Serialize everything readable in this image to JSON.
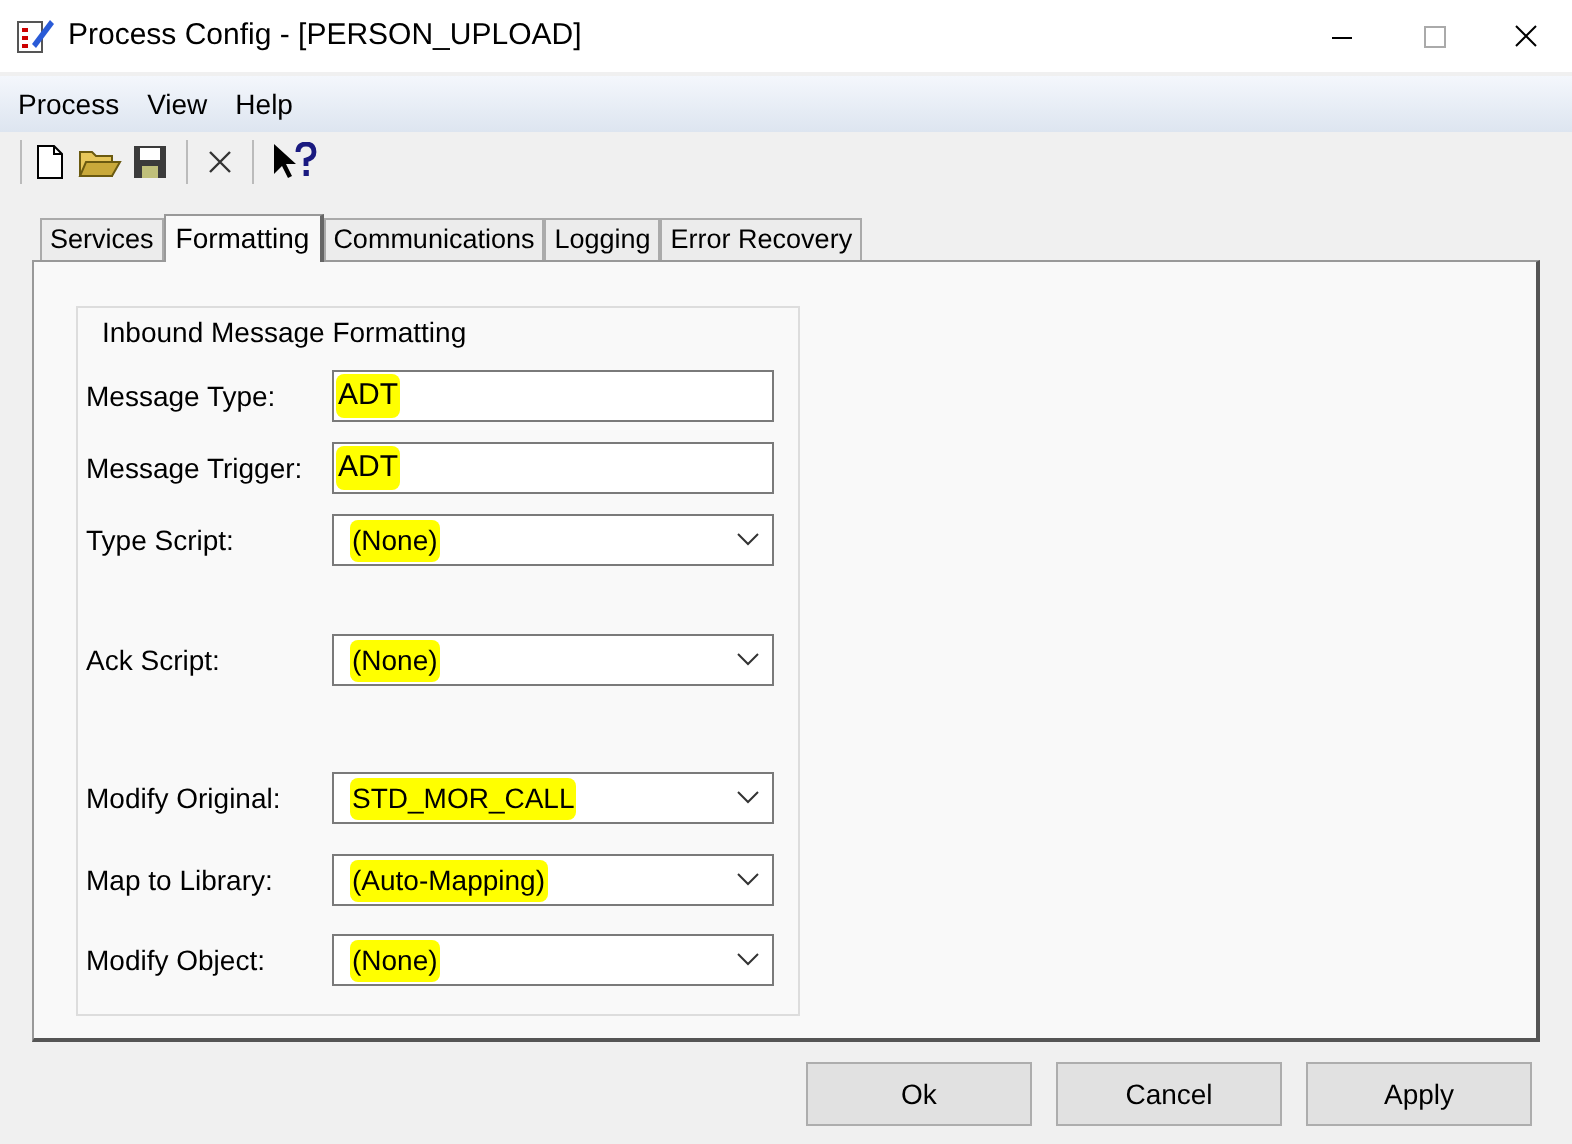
{
  "window": {
    "title": "Process Config - [PERSON_UPLOAD]"
  },
  "menu": [
    "Process",
    "View",
    "Help"
  ],
  "tabs": [
    {
      "label": "Services",
      "selected": false
    },
    {
      "label": "Formatting",
      "selected": true
    },
    {
      "label": "Communications",
      "selected": false
    },
    {
      "label": "Logging",
      "selected": false
    },
    {
      "label": "Error Recovery",
      "selected": false
    }
  ],
  "group": {
    "title": "Inbound Message Formatting"
  },
  "fields": [
    {
      "label": "Message Type:",
      "kind": "text",
      "value": "ADT",
      "highlighted": true
    },
    {
      "label": "Message Trigger:",
      "kind": "text",
      "value": "ADT",
      "highlighted": true
    },
    {
      "label": "Type Script:",
      "kind": "combo",
      "value": "(None)",
      "highlighted": true
    },
    {
      "label": "Ack Script:",
      "kind": "combo",
      "value": "(None)",
      "highlighted": true
    },
    {
      "label": "Modify Original:",
      "kind": "combo",
      "value": "STD_MOR_CALL",
      "highlighted": true
    },
    {
      "label": "Map to Library:",
      "kind": "combo",
      "value": "(Auto-Mapping)",
      "highlighted": true
    },
    {
      "label": "Modify Object:",
      "kind": "combo",
      "value": "(None)",
      "highlighted": true
    }
  ],
  "buttons": [
    "Ok",
    "Cancel",
    "Apply"
  ]
}
